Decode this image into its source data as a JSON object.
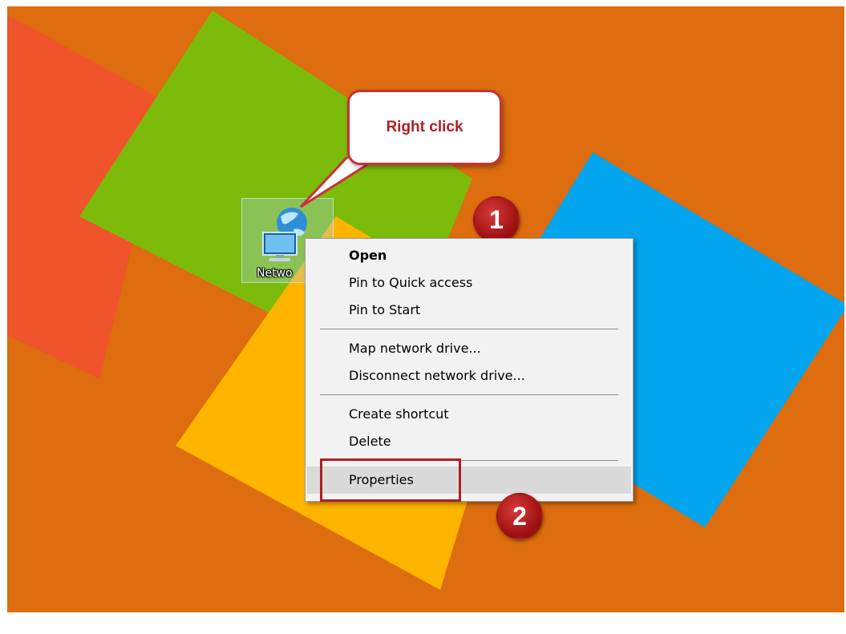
{
  "desktop": {
    "icon": {
      "label": "Netwo",
      "icon": "network-globe-monitor-icon"
    },
    "tiles": {
      "red": "#f0542a",
      "green": "#7cbb0a",
      "yellow": "#ffb400",
      "blue": "#02a5ee",
      "background": "#dd6d0e"
    }
  },
  "callout": {
    "text": "Right click"
  },
  "badges": {
    "step1": "1",
    "step2": "2"
  },
  "context_menu": {
    "items": [
      {
        "label": "Open"
      },
      {
        "label": "Pin to Quick access"
      },
      {
        "label": "Pin to Start"
      },
      {
        "label": "Map network drive..."
      },
      {
        "label": "Disconnect network drive..."
      },
      {
        "label": "Create shortcut"
      },
      {
        "label": "Delete"
      },
      {
        "label": "Properties"
      }
    ]
  },
  "colors": {
    "accent_red": "#b01f24",
    "menu_bg": "#f2f2f2",
    "highlight": "#dadada"
  }
}
